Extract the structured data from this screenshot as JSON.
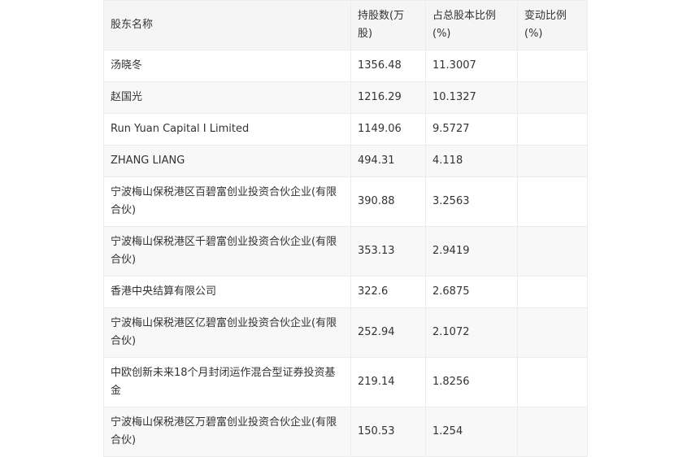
{
  "table": {
    "headers": {
      "name": "股东名称",
      "shares": "持股数(万股)",
      "ratio": "占总股本比例(%)",
      "change": "变动比例(%)"
    },
    "rows": [
      {
        "name": "汤晓冬",
        "shares": "1356.48",
        "ratio": "11.3007",
        "change": ""
      },
      {
        "name": "赵国光",
        "shares": "1216.29",
        "ratio": "10.1327",
        "change": ""
      },
      {
        "name": "Run Yuan Capital I Limited",
        "shares": "1149.06",
        "ratio": "9.5727",
        "change": ""
      },
      {
        "name": "ZHANG LIANG",
        "shares": "494.31",
        "ratio": "4.118",
        "change": ""
      },
      {
        "name": "宁波梅山保税港区百碧富创业投资合伙企业(有限合伙)",
        "shares": "390.88",
        "ratio": "3.2563",
        "change": ""
      },
      {
        "name": "宁波梅山保税港区千碧富创业投资合伙企业(有限合伙)",
        "shares": "353.13",
        "ratio": "2.9419",
        "change": ""
      },
      {
        "name": "香港中央结算有限公司",
        "shares": "322.6",
        "ratio": "2.6875",
        "change": ""
      },
      {
        "name": "宁波梅山保税港区亿碧富创业投资合伙企业(有限合伙)",
        "shares": "252.94",
        "ratio": "2.1072",
        "change": ""
      },
      {
        "name": "中欧创新未来18个月封闭运作混合型证券投资基金",
        "shares": "219.14",
        "ratio": "1.8256",
        "change": ""
      },
      {
        "name": "宁波梅山保税港区万碧富创业投资合伙企业(有限合伙)",
        "shares": "150.53",
        "ratio": "1.254",
        "change": ""
      }
    ]
  }
}
